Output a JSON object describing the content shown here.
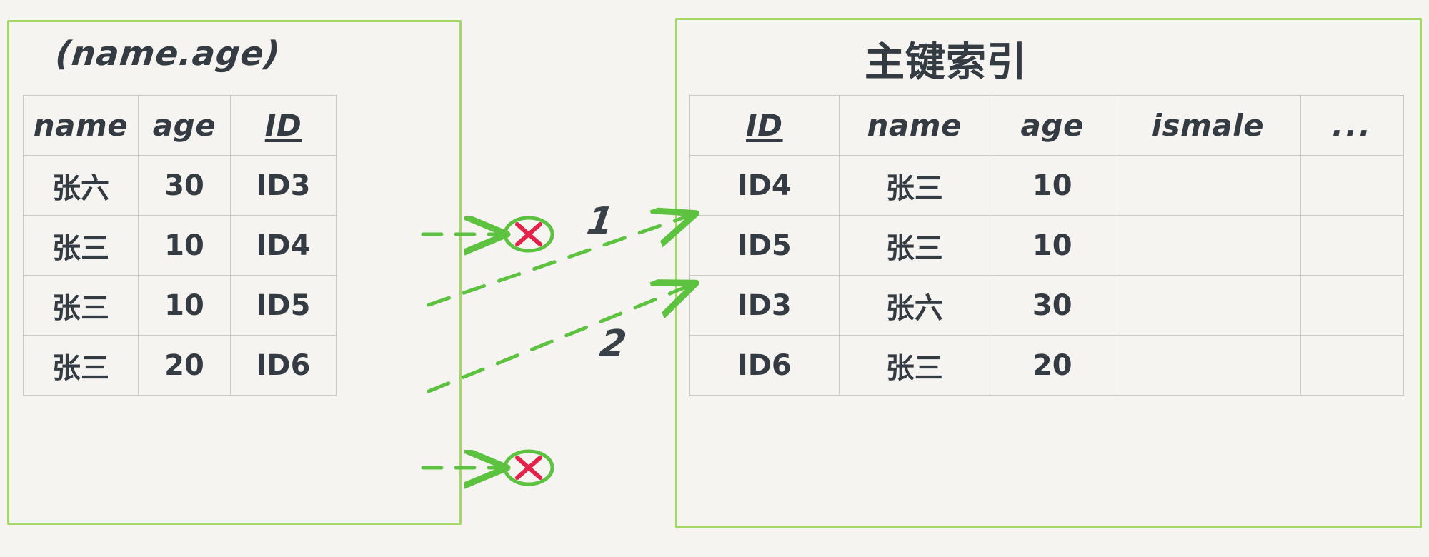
{
  "diagram": {
    "title_hidden": "",
    "colors": {
      "background": "#f5f4f0",
      "panel_border": "#a3d868",
      "text": "#343b42",
      "grid_line": "#c9c9c4",
      "arrow_green": "#5cc23f",
      "marker_red": "#e3224a"
    }
  },
  "left_panel": {
    "caption": "(name.age)",
    "table": {
      "headers": [
        "name",
        "age",
        "ID"
      ],
      "underlined_header": "ID",
      "rows": [
        {
          "name": "张六",
          "age": "30",
          "id": "ID3"
        },
        {
          "name": "张三",
          "age": "10",
          "id": "ID4"
        },
        {
          "name": "张三",
          "age": "10",
          "id": "ID5"
        },
        {
          "name": "张三",
          "age": "20",
          "id": "ID6"
        }
      ]
    }
  },
  "right_panel": {
    "caption": "主键索引",
    "table": {
      "headers": [
        "ID",
        "name",
        "age",
        "ismale",
        "..."
      ],
      "underlined_header": "ID",
      "rows": [
        {
          "id": "ID4",
          "name": "张三",
          "age": "10",
          "ismale": "",
          "more": ""
        },
        {
          "id": "ID5",
          "name": "张三",
          "age": "10",
          "ismale": "",
          "more": ""
        },
        {
          "id": "ID3",
          "name": "张六",
          "age": "30",
          "ismale": "",
          "more": ""
        },
        {
          "id": "ID6",
          "name": "张三",
          "age": "20",
          "ismale": "",
          "more": ""
        }
      ]
    }
  },
  "annotations": {
    "steps": [
      {
        "label": "1",
        "from": "ID4",
        "to": "ID4"
      },
      {
        "label": "2",
        "from": "ID5",
        "to": "ID5"
      }
    ],
    "rejected_markers": [
      {
        "source_row_id": "ID3",
        "symbol": "circle-x"
      },
      {
        "source_row_id": "ID6",
        "symbol": "circle-x"
      }
    ]
  }
}
